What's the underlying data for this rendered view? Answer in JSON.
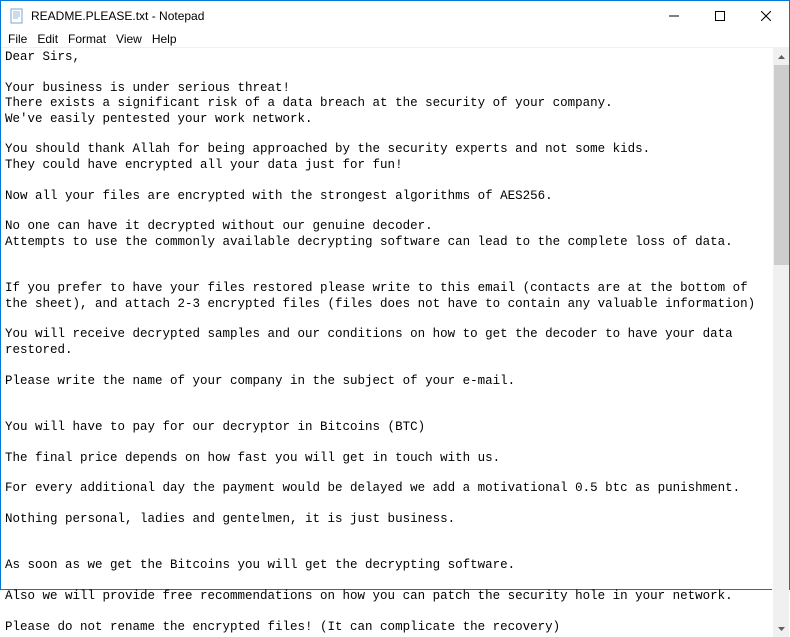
{
  "window": {
    "title": "README.PLEASE.txt - Notepad"
  },
  "menu": {
    "file": "File",
    "edit": "Edit",
    "format": "Format",
    "view": "View",
    "help": "Help"
  },
  "content": {
    "text": "Dear Sirs,\n\nYour business is under serious threat!\nThere exists a significant risk of a data breach at the security of your company.\nWe've easily pentested your work network.\n\nYou should thank Allah for being approached by the security experts and not some kids.\nThey could have encrypted all your data just for fun!\n\nNow all your files are encrypted with the strongest algorithms of AES256.\n\nNo one can have it decrypted without our genuine decoder.\nAttempts to use the commonly available decrypting software can lead to the complete loss of data.\n\n\nIf you prefer to have your files restored please write to this email (contacts are at the bottom of the sheet), and attach 2-3 encrypted files (files does not have to contain any valuable information)\n\nYou will receive decrypted samples and our conditions on how to get the decoder to have your data restored.\n\nPlease write the name of your company in the subject of your e-mail.\n\n\nYou will have to pay for our decryptor in Bitcoins (BTC)\n\nThe final price depends on how fast you will get in touch with us.\n\nFor every additional day the payment would be delayed we add a motivational 0.5 btc as punishment.\n\nNothing personal, ladies and gentelmen, it is just business.\n\n\nAs soon as we get the Bitcoins you will get the decrypting software.\n\nAlso we will provide free recommendations on how you can patch the security hole in your network.\n\nPlease do not rename the encrypted files! (It can complicate the recovery)"
  }
}
